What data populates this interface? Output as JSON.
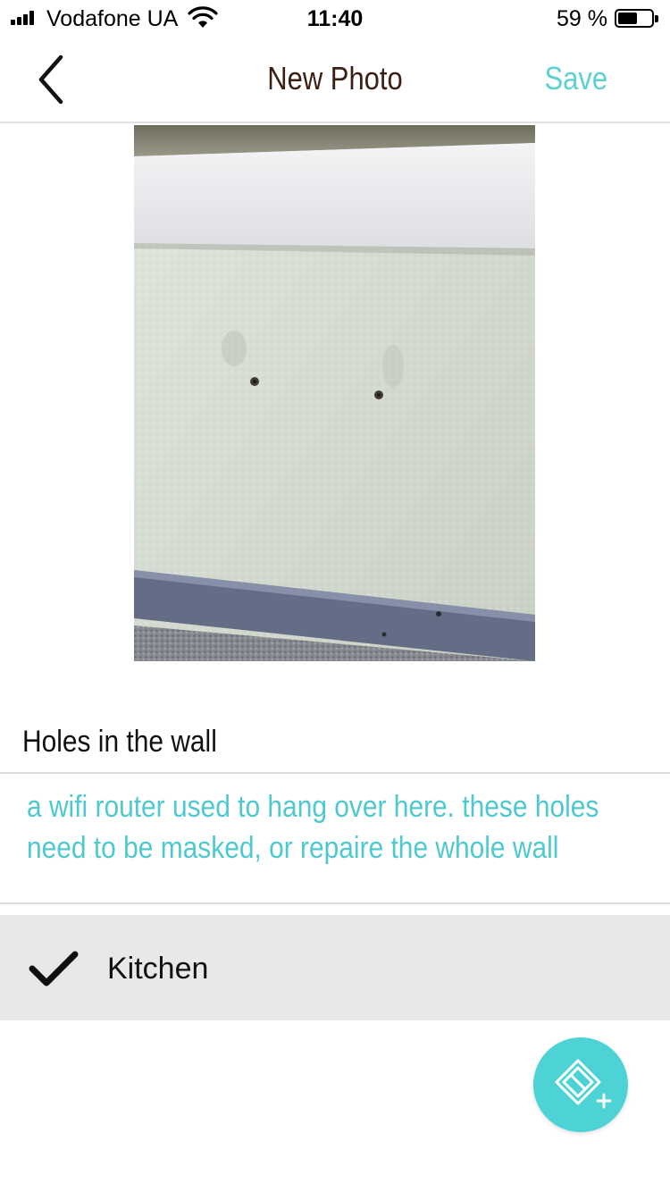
{
  "status_bar": {
    "carrier": "Vodafone UA",
    "time": "11:40",
    "battery_percent": "59 %",
    "battery_level": 0.59
  },
  "nav": {
    "title": "New Photo",
    "save_label": "Save"
  },
  "photo": {
    "title": "Holes in the wall",
    "description": "a wifi router used to hang over here. these holes need to be masked, or repaire the whole wall"
  },
  "room": {
    "label": "Kitchen",
    "selected": true
  },
  "colors": {
    "accent": "#4fc9cf",
    "title_text": "#3b1f12",
    "row_background": "#e8e8e8",
    "fab": "#4dd3d6"
  },
  "icons": {
    "back": "chevron-left-icon",
    "check": "checkmark-icon",
    "fab": "add-floorplan-icon"
  }
}
